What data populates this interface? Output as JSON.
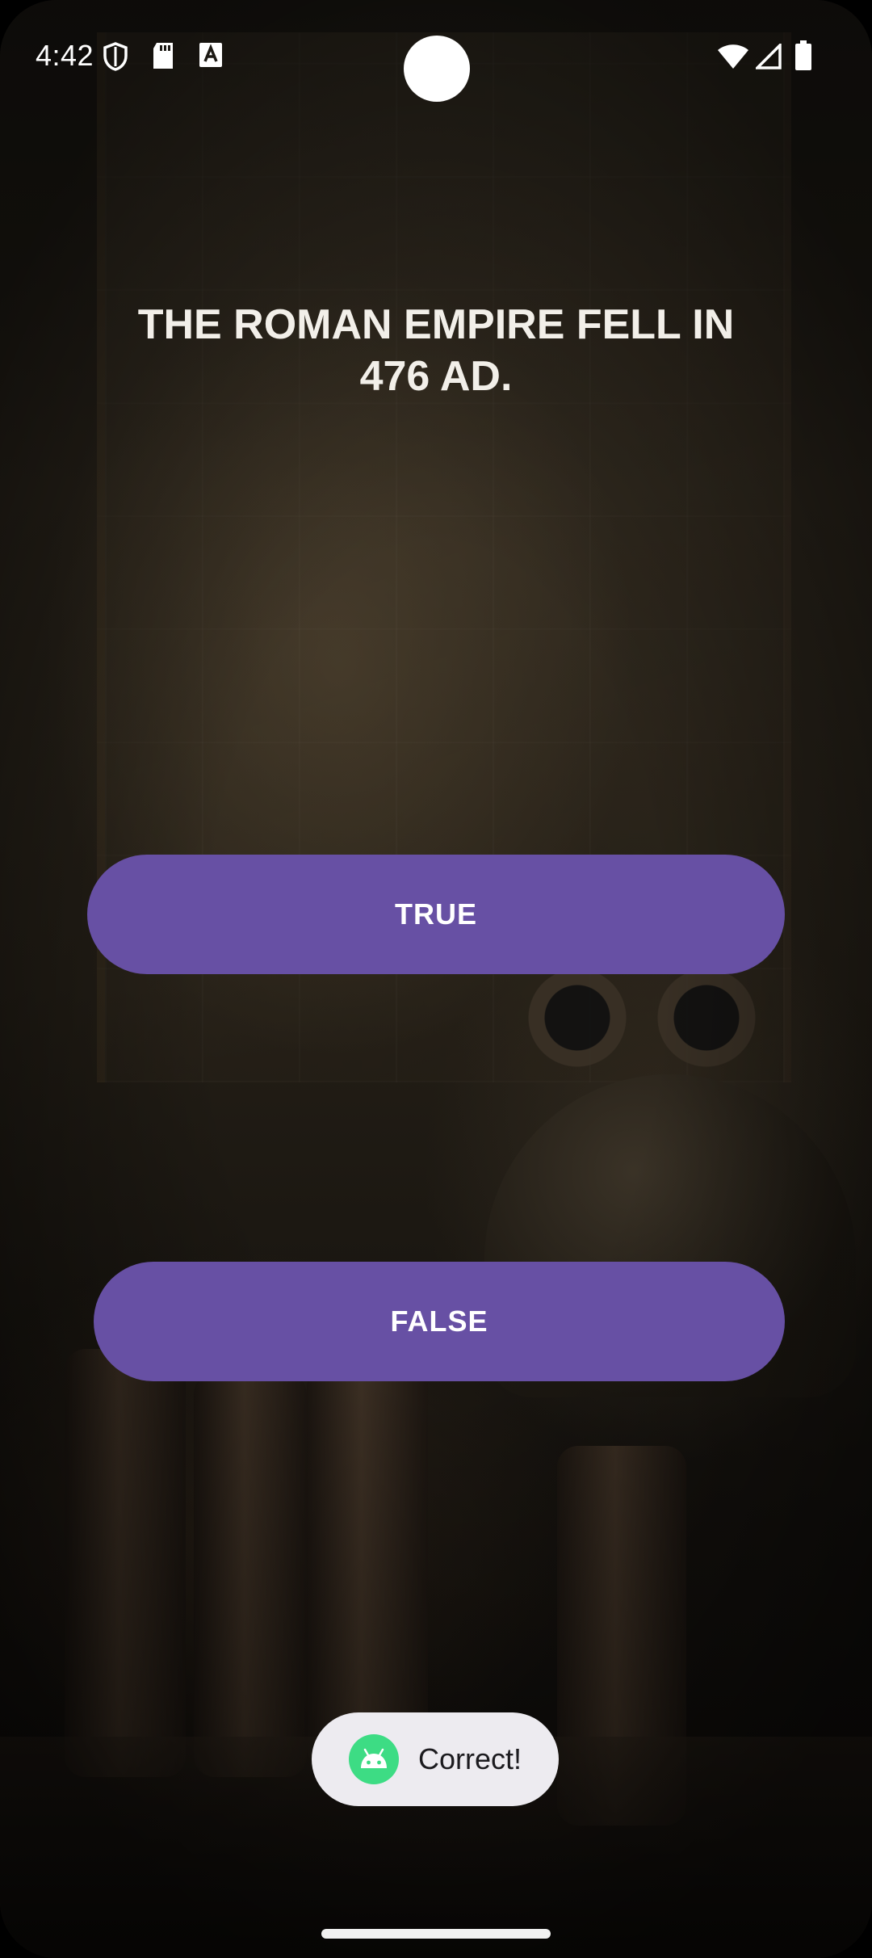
{
  "status_bar": {
    "time": "4:42",
    "icons": [
      "shield-icon",
      "sd-card-icon",
      "font-a-icon",
      "wifi-icon",
      "cell-signal-icon",
      "battery-icon"
    ]
  },
  "quiz": {
    "question": "THE ROMAN EMPIRE FELL IN 476 AD.",
    "true_label": "TRUE",
    "false_label": "FALSE"
  },
  "toast": {
    "message": "Correct!",
    "icon": "android-icon"
  },
  "colors": {
    "button": "#6750a4",
    "toast_bg": "#edebf0",
    "android_green": "#3ddc84"
  }
}
